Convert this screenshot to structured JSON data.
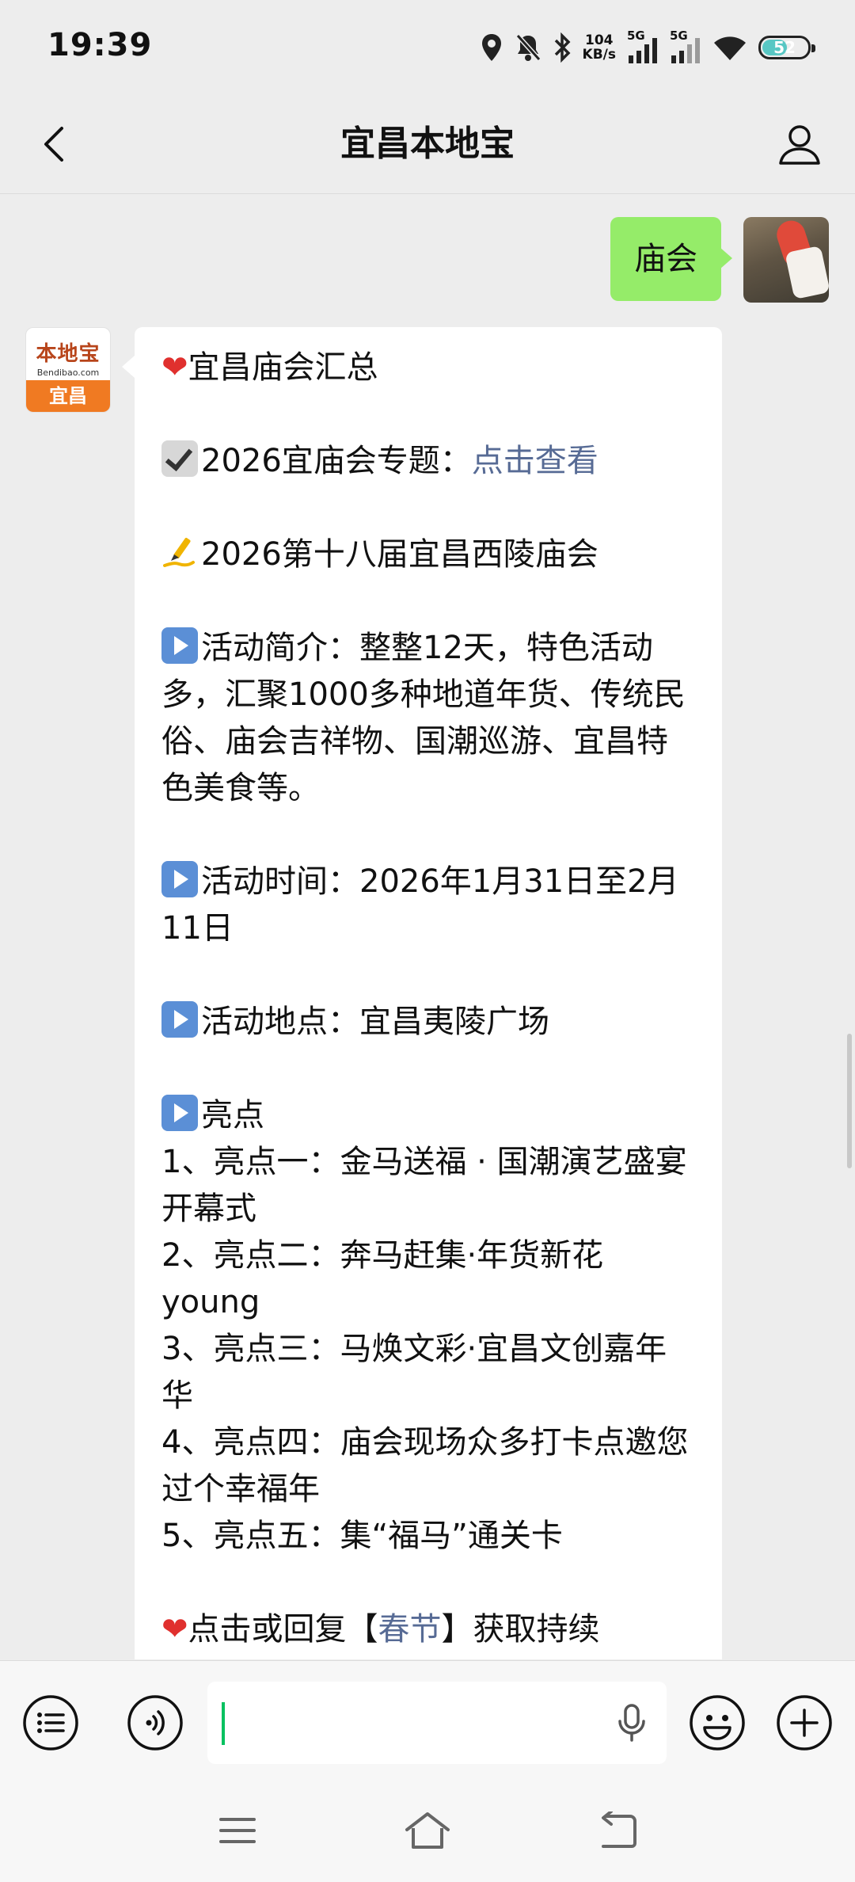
{
  "status_bar": {
    "time": "19:39",
    "net_speed_value": "104",
    "net_speed_unit": "KB/s",
    "signal1_label": "5G",
    "signal2_label": "5G",
    "battery_level": "52",
    "icons": [
      "location-icon",
      "mute-icon",
      "bluetooth-icon",
      "signal-icon",
      "wifi-icon",
      "battery-icon"
    ]
  },
  "header": {
    "title": "宜昌本地宝"
  },
  "chat": {
    "my_message": "庙会",
    "bot_avatar": {
      "logo_text": "本地宝",
      "logo_sub": "Bendibao.com",
      "city": "宜昌"
    },
    "bot_message": {
      "l1": "宜昌庙会汇总",
      "l2_prefix": "2026宜庙会专题：",
      "l2_link": "点击查看",
      "l3": "2026第十八届宜昌西陵庙会",
      "intro": "活动简介：整整12天，特色活动多，汇聚1000多种地道年货、传统民俗、庙会吉祥物、国潮巡游、宜昌特色美食等。",
      "time": "活动时间：2026年1月31日至2月11日",
      "place": "活动地点：宜昌夷陵广场",
      "highlights_title": "亮点",
      "h1": "1、亮点一：金马送福 · 国潮演艺盛宴开幕式",
      "h2": "2、亮点二：奔马赶集·年货新花young",
      "h3": "3、亮点三：马焕文彩·宜昌文创嘉年华",
      "h4": "4、亮点四：庙会现场众多打卡点邀您过个幸福年",
      "h5": "5、亮点五：集“福马”通关卡",
      "last_prefix": "点击或回复【",
      "last_link": "春节",
      "last_suffix": "】获取持续"
    }
  },
  "input_bar": {
    "input_value": "",
    "buttons": [
      "menu-icon",
      "voice-icon",
      "mic-icon",
      "emoji-icon",
      "plus-icon"
    ]
  },
  "nav_bar": {
    "buttons": [
      "recent-apps-icon",
      "home-icon",
      "back-icon"
    ]
  },
  "colors": {
    "my_bubble": "#95ec69",
    "link": "#576b95",
    "background": "#ededed",
    "caret": "#07c160"
  }
}
